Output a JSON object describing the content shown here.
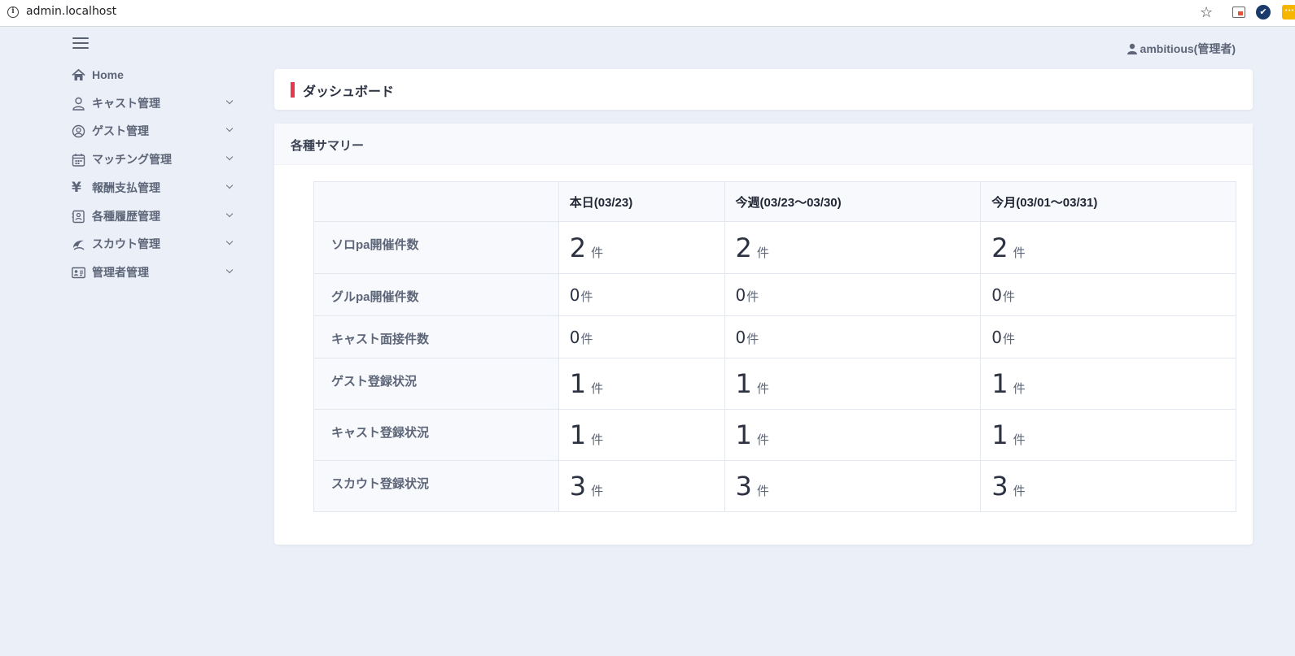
{
  "browser": {
    "url": "admin.localhost",
    "star_icon": "star-icon",
    "ext2_glyph": "✔",
    "ext3_glyph": "···"
  },
  "sidebar": {
    "items": [
      {
        "label": "Home",
        "icon": "home-icon",
        "has_submenu": false
      },
      {
        "label": "キャスト管理",
        "icon": "user-icon",
        "has_submenu": true
      },
      {
        "label": "ゲスト管理",
        "icon": "user-circle-icon",
        "has_submenu": true
      },
      {
        "label": "マッチング管理",
        "icon": "calendar-icon",
        "has_submenu": true
      },
      {
        "label": "報酬支払管理",
        "icon": "yen-icon",
        "has_submenu": true
      },
      {
        "label": "各種履歴管理",
        "icon": "history-icon",
        "has_submenu": true
      },
      {
        "label": "スカウト管理",
        "icon": "scout-icon",
        "has_submenu": true
      },
      {
        "label": "管理者管理",
        "icon": "id-card-icon",
        "has_submenu": true
      }
    ]
  },
  "header": {
    "user_name": "ambitious(管理者)"
  },
  "page": {
    "title": "ダッシュボード"
  },
  "summary": {
    "title": "各種サマリー",
    "columns": [
      "",
      "本日(03/23)",
      "今週(03/23〜03/30)",
      "今月(03/01〜03/31)"
    ],
    "unit": "件",
    "rows": [
      {
        "label": "ソロpa開催件数",
        "values": [
          "2",
          "2",
          "2"
        ],
        "size": "big"
      },
      {
        "label": "グルpa開催件数",
        "values": [
          "0",
          "0",
          "0"
        ],
        "size": "small"
      },
      {
        "label": "キャスト面接件数",
        "values": [
          "0",
          "0",
          "0"
        ],
        "size": "small"
      },
      {
        "label": "ゲスト登録状況",
        "values": [
          "1",
          "1",
          "1"
        ],
        "size": "big"
      },
      {
        "label": "キャスト登録状況",
        "values": [
          "1",
          "1",
          "1"
        ],
        "size": "big"
      },
      {
        "label": "スカウト登録状況",
        "values": [
          "3",
          "3",
          "3"
        ],
        "size": "big"
      }
    ]
  },
  "colors": {
    "accent": "#e8384f",
    "background": "#ebeff7",
    "card": "#ffffff",
    "text": "#3a4254"
  }
}
